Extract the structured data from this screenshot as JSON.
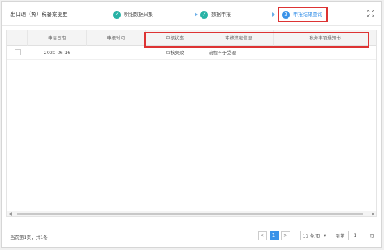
{
  "header": {
    "title": "出口退（免）税备案变更",
    "steps": [
      {
        "label": "明细数据采集",
        "state": "done"
      },
      {
        "label": "数据申报",
        "state": "done"
      },
      {
        "label": "申报结果查询",
        "state": "active",
        "number": "3"
      }
    ],
    "expand_icon": "expand-icon"
  },
  "table": {
    "columns": [
      "",
      "申请日期",
      "申报时间",
      "审核状态",
      "审核流程信息",
      "税务事项通知书"
    ],
    "rows": [
      {
        "date": "2020-06-16",
        "time": "",
        "status": "审核失败",
        "flow": "流程不予受理",
        "notice": ""
      }
    ]
  },
  "footer": {
    "summary": "当前第1页，共1条",
    "prev": "<",
    "current_page": "1",
    "next": ">",
    "page_size": "10 条/页",
    "goto_label": "到第",
    "goto_value": "1",
    "page_suffix": "页"
  },
  "colors": {
    "accent": "#3a92e8",
    "done": "#28b2a5",
    "highlight": "#dd3333"
  }
}
